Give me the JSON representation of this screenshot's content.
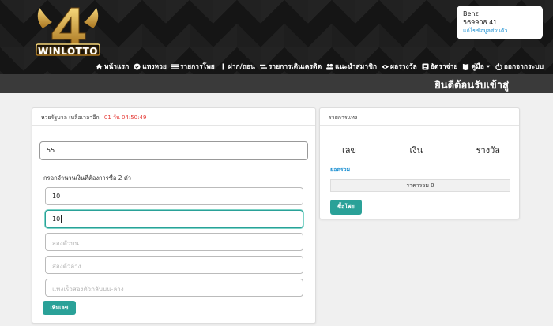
{
  "header": {
    "logo_text": "WINLOTTO",
    "user": {
      "name": "Benz",
      "credit": "569908.41",
      "edit_link": "แก้ไขข้อมูลส่วนตัว"
    },
    "nav": [
      {
        "label": "หน้าแรก",
        "icon": "home-icon"
      },
      {
        "label": "แทงหวย",
        "icon": "check-icon"
      },
      {
        "label": "รายการโพย",
        "icon": "list-icon"
      },
      {
        "label": "ฝาก/ถอน",
        "icon": "money-icon"
      },
      {
        "label": "รายการเดินเครดิต",
        "icon": "exchange-icon"
      },
      {
        "label": "แนะนำสมาชิก",
        "icon": "users-icon"
      },
      {
        "label": "ผลรางวัล",
        "icon": "eye-icon"
      },
      {
        "label": "อัตราจ่าย",
        "icon": "table-icon"
      },
      {
        "label": "คู่มือ",
        "icon": "book-icon"
      },
      {
        "label": "ออกจากระบบ",
        "icon": "power-icon"
      }
    ]
  },
  "welcome": "ยินดีต้อนรับเข้าสู่",
  "left_panel": {
    "title": "หวยรัฐบาล เหลือเวลาอีก",
    "countdown": "01 วัน 04:50:49",
    "number_value": "55",
    "instruction": "กรอกจำนวนเงินที่ต้องการซื้อ 2 ตัว",
    "inputs": [
      {
        "value": "10",
        "placeholder": ""
      },
      {
        "value": "10",
        "placeholder": ""
      },
      {
        "value": "",
        "placeholder": "สองตัวบน"
      },
      {
        "value": "",
        "placeholder": "สองตัวล่าง"
      },
      {
        "value": "",
        "placeholder": "แทงเร็วสองตัวกลับบน-ล่าง"
      }
    ],
    "add_button": "เพิ่มเลข"
  },
  "right_panel": {
    "title": "รายการแทง",
    "columns": [
      "เลข",
      "เงิน",
      "รางวัล"
    ],
    "sum_link": "ยอดรวม",
    "total": "ราคารวม 0",
    "buy_button": "ซื้อโพย"
  },
  "colors": {
    "accent": "#2aa198",
    "countdown": "#e53935",
    "link": "#1a8fd1",
    "dark": "#3a3a3a"
  }
}
